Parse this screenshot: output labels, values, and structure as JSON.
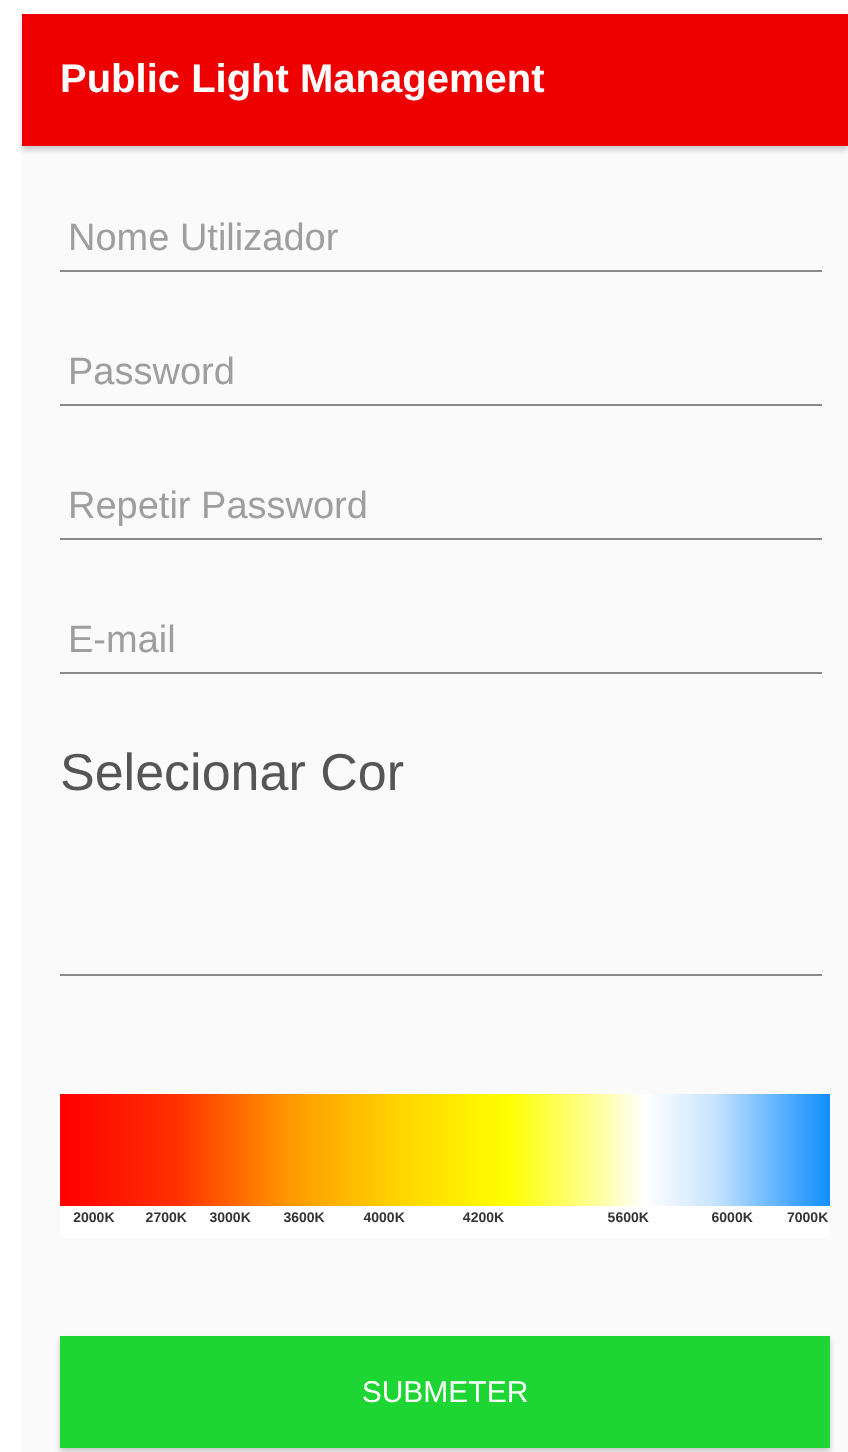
{
  "app_bar": {
    "title": "Public Light Management"
  },
  "fields": [
    {
      "placeholder": "Nome Utilizador"
    },
    {
      "placeholder": "Password"
    },
    {
      "placeholder": "Repetir Password"
    },
    {
      "placeholder": "E-mail"
    }
  ],
  "color_section": {
    "label": "Selecionar Cor",
    "scale": [
      "2000K",
      "2700K",
      "3000K",
      "3600K",
      "4000K",
      "4200K",
      "5600K",
      "6000K",
      "7000K"
    ]
  },
  "submit_button": {
    "label": "SUBMETER"
  }
}
